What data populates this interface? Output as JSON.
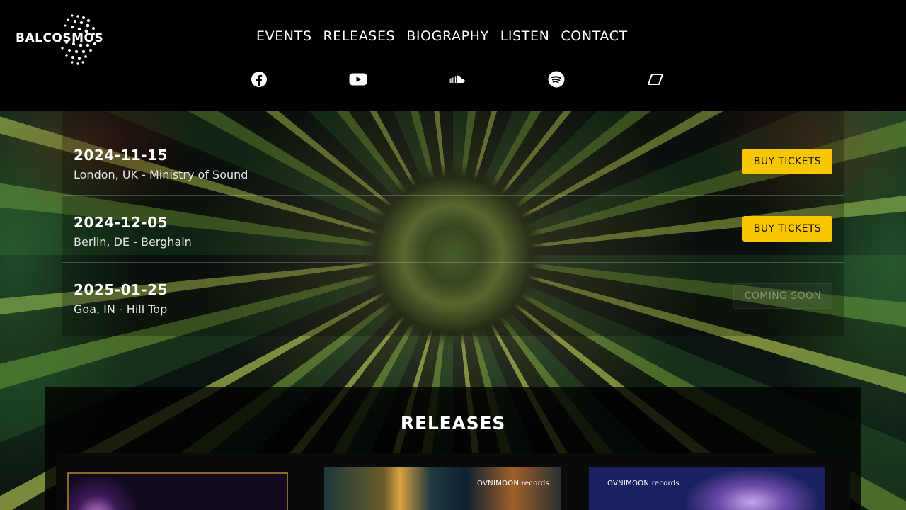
{
  "brand": {
    "name": "BALCOSMOS"
  },
  "nav": {
    "items": [
      "EVENTS",
      "RELEASES",
      "BIOGRAPHY",
      "LISTEN",
      "CONTACT"
    ]
  },
  "social": [
    "facebook-icon",
    "youtube-icon",
    "soundcloud-icon",
    "spotify-icon",
    "beatport-icon"
  ],
  "events": {
    "rows": [
      {
        "date": "2024-11-15",
        "venue": "London, UK - Ministry of Sound",
        "action": "BUY TICKETS"
      },
      {
        "date": "2024-12-05",
        "venue": "Berlin, DE - Berghain",
        "action": "BUY TICKETS"
      },
      {
        "date": "2025-01-25",
        "venue": "Goa, IN - Hill Top",
        "action": "COMING SOON"
      }
    ]
  },
  "releases": {
    "title": "RELEASES",
    "covers": [
      {
        "label": ""
      },
      {
        "label": "OVNIMOON records"
      },
      {
        "label": "OVNIMOON records"
      }
    ]
  },
  "colors": {
    "accent": "#f7c600",
    "header_bg": "#000000"
  }
}
